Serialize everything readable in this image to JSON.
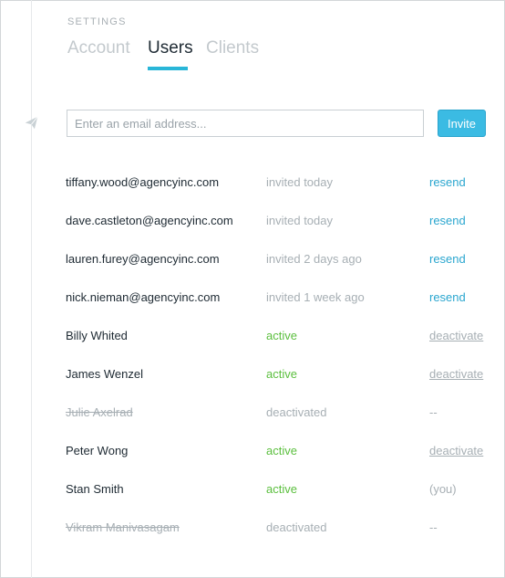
{
  "header": {
    "section_label": "SETTINGS",
    "tabs": [
      {
        "label": "Account",
        "active": false
      },
      {
        "label": "Users",
        "active": true
      },
      {
        "label": "Clients",
        "active": false
      }
    ]
  },
  "invite": {
    "placeholder": "Enter an email address...",
    "value": "",
    "button_label": "Invite",
    "icon": "paper-plane-icon"
  },
  "users": [
    {
      "name": "tiffany.wood@agencyinc.com",
      "status": "invited today",
      "status_type": "invited",
      "action": "resend",
      "action_type": "resend"
    },
    {
      "name": "dave.castleton@agencyinc.com",
      "status": "invited today",
      "status_type": "invited",
      "action": "resend",
      "action_type": "resend"
    },
    {
      "name": "lauren.furey@agencyinc.com",
      "status": "invited 2 days ago",
      "status_type": "invited",
      "action": "resend",
      "action_type": "resend"
    },
    {
      "name": "nick.nieman@agencyinc.com",
      "status": "invited 1 week ago",
      "status_type": "invited",
      "action": "resend",
      "action_type": "resend"
    },
    {
      "name": "Billy Whited",
      "status": "active",
      "status_type": "active",
      "action": "deactivate",
      "action_type": "deactivate"
    },
    {
      "name": "James Wenzel",
      "status": "active",
      "status_type": "active",
      "action": "deactivate",
      "action_type": "deactivate"
    },
    {
      "name": "Julie Axelrad",
      "status": "deactivated",
      "status_type": "deactivated",
      "action": "--",
      "action_type": "none"
    },
    {
      "name": "Peter Wong",
      "status": "active",
      "status_type": "active",
      "action": "deactivate",
      "action_type": "deactivate"
    },
    {
      "name": "Stan Smith",
      "status": "active",
      "status_type": "active",
      "action": "(you)",
      "action_type": "self"
    },
    {
      "name": "Vikram Manivasagam",
      "status": "deactivated",
      "status_type": "deactivated",
      "action": "--",
      "action_type": "none"
    }
  ],
  "colors": {
    "accent": "#29b6d8",
    "button": "#3bbbe3",
    "active_status": "#5bbf3e",
    "link": "#2aa6cf",
    "muted": "#a7afb4"
  }
}
